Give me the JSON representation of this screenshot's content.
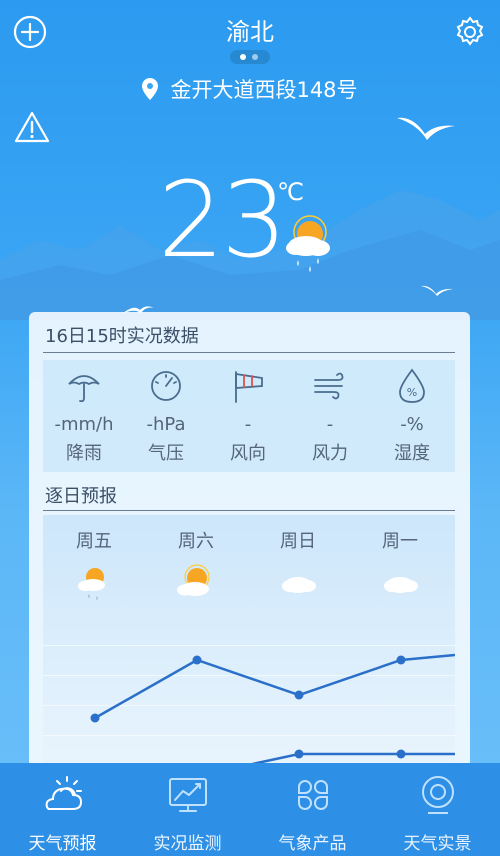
{
  "header": {
    "city": "渝北",
    "location": "金开大道西段148号"
  },
  "current": {
    "temperature": "23",
    "unit": "℃",
    "weather_icon": "partly-sunny-rain-icon"
  },
  "observation": {
    "title": "16日15时实况数据",
    "items": [
      {
        "icon": "umbrella-icon",
        "value": "-mm/h",
        "label": "降雨"
      },
      {
        "icon": "gauge-icon",
        "value": "-hPa",
        "label": "气压"
      },
      {
        "icon": "windsock-icon",
        "value": "-",
        "label": "风向"
      },
      {
        "icon": "wind-icon",
        "value": "-",
        "label": "风力"
      },
      {
        "icon": "humidity-drop-icon",
        "value": "-%",
        "label": "湿度"
      }
    ]
  },
  "forecast": {
    "title": "逐日预报",
    "days": [
      {
        "label": "周五",
        "icon": "sun-cloud-rain-icon"
      },
      {
        "label": "周六",
        "icon": "sun-cloud-icon"
      },
      {
        "label": "周日",
        "icon": "cloud-icon"
      },
      {
        "label": "周一",
        "icon": "cloud-icon"
      }
    ]
  },
  "nav": [
    {
      "label": "天气预报",
      "icon": "weather-forecast-icon",
      "active": true
    },
    {
      "label": "实况监测",
      "icon": "monitor-chart-icon",
      "active": false
    },
    {
      "label": "气象产品",
      "icon": "products-grid-icon",
      "active": false
    },
    {
      "label": "天气实景",
      "icon": "live-camera-icon",
      "active": false
    }
  ],
  "colors": {
    "accent": "#2d8fe5",
    "line": "#2a6fc9",
    "card_text": "#3c4f66"
  }
}
